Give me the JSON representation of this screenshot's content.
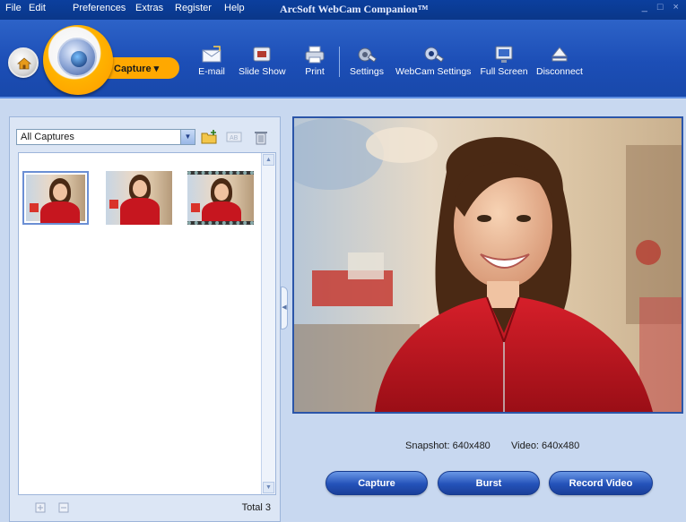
{
  "menu": [
    "File",
    "Edit",
    "Preferences",
    "Extras",
    "Register",
    "Help"
  ],
  "app_title": "ArcSoft WebCam Companion™",
  "window_controls": "_ □ ×",
  "mode_tab": "Capture ▾",
  "toolbar": {
    "email": "E-mail",
    "slideshow": "Slide Show",
    "print": "Print",
    "settings": "Settings",
    "webcam_settings": "WebCam Settings",
    "fullscreen": "Full Screen",
    "disconnect": "Disconnect"
  },
  "captures": {
    "folder_selected": "All Captures",
    "total_label": "Total 3",
    "thumbnails": [
      {
        "type": "photo",
        "selected": true
      },
      {
        "type": "photo",
        "selected": false
      },
      {
        "type": "video",
        "selected": false
      }
    ]
  },
  "preview": {
    "snapshot_res": "Snapshot: 640x480",
    "video_res": "Video: 640x480"
  },
  "actions": {
    "capture": "Capture",
    "burst": "Burst",
    "record": "Record Video"
  },
  "colors": {
    "toolbar_blue": "#1c4eb6",
    "accent_orange": "#ffa800",
    "panel_bg": "#c8d8f0",
    "button_blue": "#2452b9"
  }
}
